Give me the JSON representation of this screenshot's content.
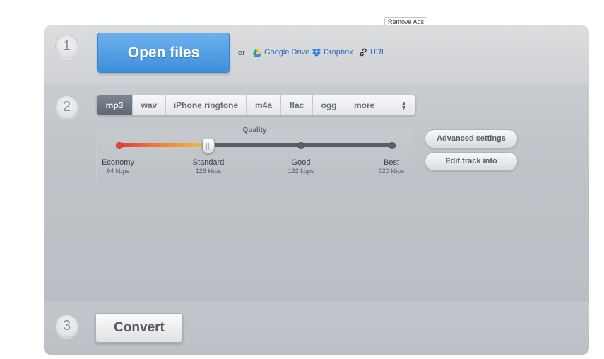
{
  "top": {
    "remove_ads_label": "Remove Ads"
  },
  "step1": {
    "number": "1",
    "open_files_label": "Open files",
    "or_label": "or",
    "google_drive_label": "Google Drive",
    "dropbox_label": "Dropbox",
    "url_label": "URL"
  },
  "step2": {
    "number": "2",
    "formats": [
      "mp3",
      "wav",
      "iPhone ringtone",
      "m4a",
      "flac",
      "ogg"
    ],
    "more_label": "more",
    "selected_format": "mp3",
    "quality": {
      "title": "Quality",
      "selected_level": "Standard",
      "levels": [
        {
          "name": "Economy",
          "bitrate": "64 kbps"
        },
        {
          "name": "Standard",
          "bitrate": "128 kbps"
        },
        {
          "name": "Good",
          "bitrate": "192 kbps"
        },
        {
          "name": "Best",
          "bitrate": "320 kbps"
        }
      ]
    },
    "advanced_settings_label": "Advanced settings",
    "edit_track_info_label": "Edit track info"
  },
  "step3": {
    "number": "3",
    "convert_label": "Convert"
  },
  "colors": {
    "accent_blue": "#4b9ae3",
    "link_blue": "#2a6bc1",
    "slider_low": "#e23b3b",
    "slider_mid": "#e9c640"
  },
  "icons": {
    "google_drive": "google-drive-icon",
    "dropbox": "dropbox-icon",
    "url": "link-icon"
  }
}
